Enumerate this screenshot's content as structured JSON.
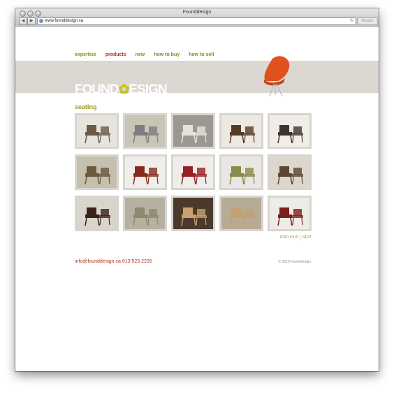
{
  "browser": {
    "window_title": "Founddesign",
    "url": "www.founddesign.ca",
    "reader_label": "Reader"
  },
  "site": {
    "nav": [
      "expertise",
      "products",
      "new",
      "how to buy",
      "how to sell"
    ],
    "active_nav": "products",
    "logo_part1": "FOUND",
    "logo_dot": "✿",
    "logo_part2": "ESIGN",
    "section_title": "seating",
    "products": [
      {
        "name": "chairs-and-table-set",
        "bg": "#e6e4df"
      },
      {
        "name": "stacking-chairs",
        "bg": "#c9c4b8"
      },
      {
        "name": "white-chairs-row",
        "bg": "#9a9890"
      },
      {
        "name": "lounge-chair-ottoman",
        "bg": "#ece9e3"
      },
      {
        "name": "pair-lounge-chairs",
        "bg": "#f0ede8"
      },
      {
        "name": "upholstered-armchairs",
        "bg": "#c6bfae"
      },
      {
        "name": "red-armchair",
        "bg": "#efeeea"
      },
      {
        "name": "red-highback-chair",
        "bg": "#eeedea"
      },
      {
        "name": "round-side-table",
        "bg": "#e9e7e3"
      },
      {
        "name": "dining-chair-set",
        "bg": "#dcd7cd"
      },
      {
        "name": "bar-stools",
        "bg": "#d9d4cc"
      },
      {
        "name": "shell-chairs",
        "bg": "#b6b0a2"
      },
      {
        "name": "tall-back-chairs",
        "bg": "#4a3a2c"
      },
      {
        "name": "floor-lamp",
        "bg": "#b7ab96"
      },
      {
        "name": "red-sofa",
        "bg": "#eeece7"
      }
    ],
    "pager": {
      "previous": "PREVIOUS",
      "next": "NEXT"
    },
    "contact": "info@founddesign.ca   613 523 2205",
    "copyright": "© 2010 Founddesign"
  },
  "colors": {
    "nav": "#8a8d1a",
    "active": "#b4301c",
    "accent_chair": "#e1511e"
  }
}
